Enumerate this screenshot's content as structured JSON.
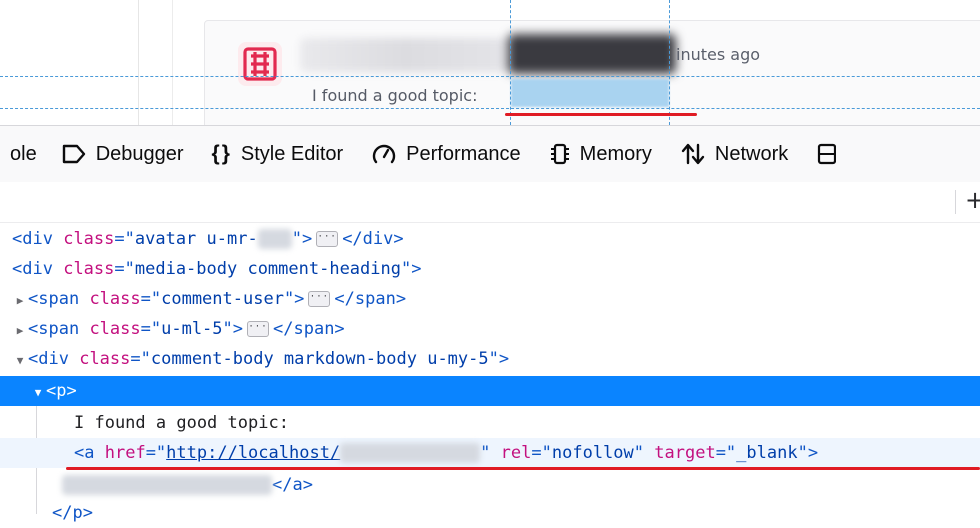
{
  "preview": {
    "time_text": "inutes ago",
    "comment_text": "I found a good topic:"
  },
  "toolbar": {
    "tabs": [
      {
        "label": "ole",
        "icon": "console-icon"
      },
      {
        "label": "Debugger",
        "icon": "debugger-icon"
      },
      {
        "label": "Style Editor",
        "icon": "braces-icon"
      },
      {
        "label": "Performance",
        "icon": "gauge-icon"
      },
      {
        "label": "Memory",
        "icon": "memory-chip-icon"
      },
      {
        "label": "Network",
        "icon": "arrows-updown-icon"
      }
    ]
  },
  "subbar": {
    "add_label": "+"
  },
  "markup": {
    "l1": {
      "open": "<div",
      "attr": "class",
      "eq": "=\"",
      "val": "avatar u-mr-",
      "close": "\">",
      "end": "</div>"
    },
    "l2": {
      "open": "<div",
      "attr": "class",
      "eq": "=\"",
      "val": "media-body comment-heading",
      "close": "\">"
    },
    "l3": {
      "open": "<span",
      "attr": "class",
      "eq": "=\"",
      "val": "comment-user",
      "close": "\">",
      "end": "</span>"
    },
    "l4": {
      "open": "<span",
      "attr": "class",
      "eq": "=\"",
      "val": "u-ml-5",
      "close": "\">",
      "end": "</span>"
    },
    "l5": {
      "open": "<div",
      "attr": "class",
      "eq": "=\"",
      "val": "comment-body markdown-body u-my-5",
      "close": "\">"
    },
    "l6": {
      "tag": "<p>"
    },
    "l7": {
      "text": "I found a good topic:"
    },
    "l8": {
      "open": "<a",
      "attr1": "href",
      "val1": "http://localhost/",
      "attr2": "rel",
      "val2": "nofollow",
      "attr3": "target",
      "val3": "_blank",
      "close": "\">"
    },
    "l9": {
      "end": "</a>"
    },
    "l10": {
      "end": "</p>"
    }
  },
  "colors": {
    "tag": "#0f55c6",
    "attribute": "#c3107f",
    "value": "#003eaa",
    "selection": "#0a84ff",
    "annotation_red": "#e01b24"
  }
}
